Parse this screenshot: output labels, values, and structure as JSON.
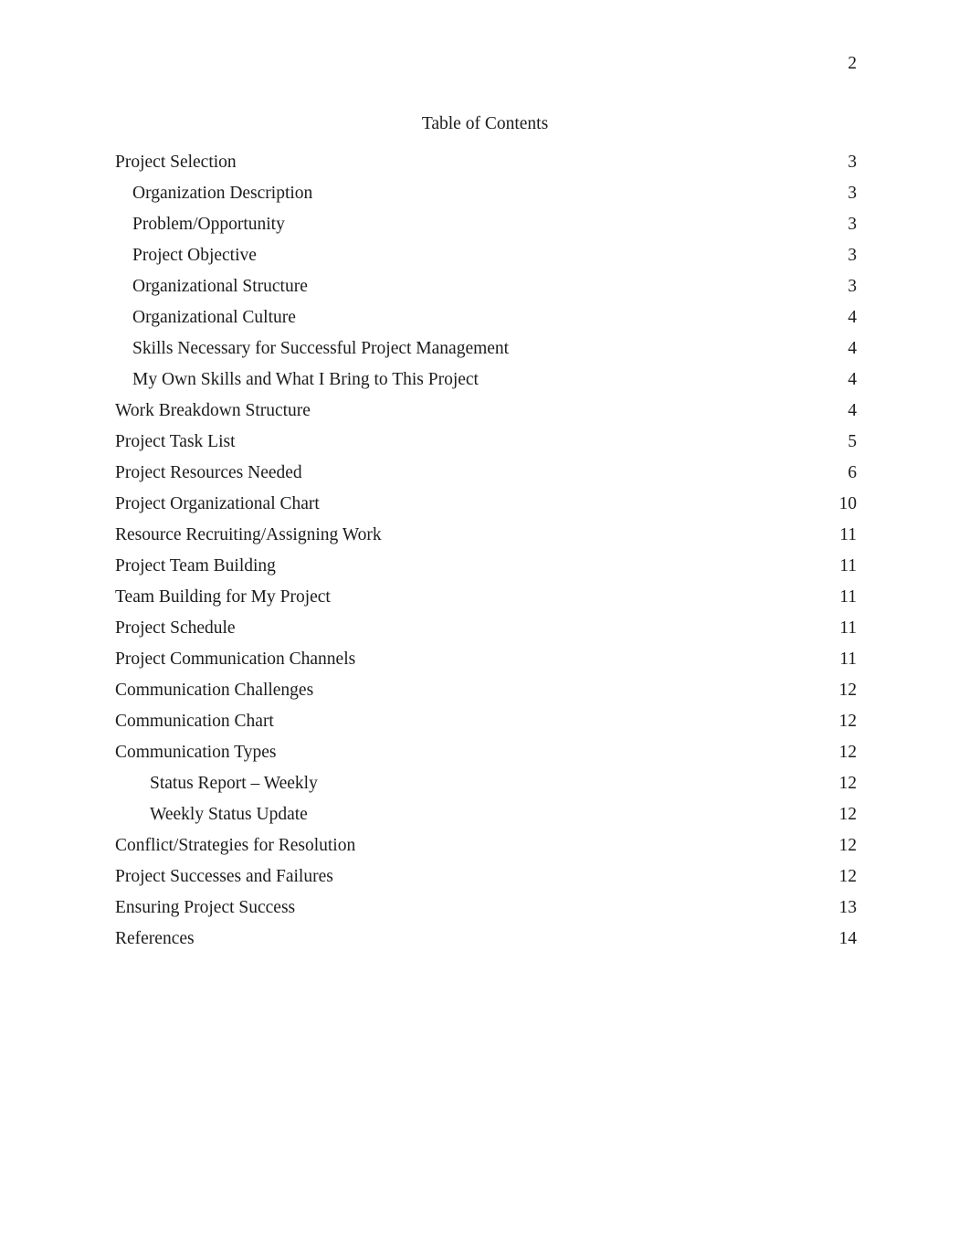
{
  "document": {
    "header_page_number": "2",
    "title": "Table of Contents"
  },
  "toc": {
    "entries": [
      {
        "label": "Project Selection",
        "page": "3",
        "level": 1
      },
      {
        "label": "Organization Description",
        "page": "3",
        "level": 2
      },
      {
        "label": "Problem/Opportunity",
        "page": "3",
        "level": 2
      },
      {
        "label": "Project Objective",
        "page": "3",
        "level": 2
      },
      {
        "label": "Organizational Structure",
        "page": "3",
        "level": 2
      },
      {
        "label": "Organizational Culture",
        "page": "4",
        "level": 2
      },
      {
        "label": "Skills Necessary for Successful Project Management",
        "page": "4",
        "level": 2
      },
      {
        "label": "My Own Skills and What I Bring to This Project",
        "page": "4",
        "level": 2
      },
      {
        "label": "Work Breakdown Structure",
        "page": "4",
        "level": 1
      },
      {
        "label": "Project Task List",
        "page": "5",
        "level": 1
      },
      {
        "label": "Project Resources Needed",
        "page": "6",
        "level": 1
      },
      {
        "label": "Project Organizational Chart",
        "page": "10",
        "level": 1
      },
      {
        "label": "Resource Recruiting/Assigning Work",
        "page": "11",
        "level": 1
      },
      {
        "label": "Project Team Building",
        "page": "11",
        "level": 1
      },
      {
        "label": "Team Building for My Project",
        "page": "11",
        "level": 1
      },
      {
        "label": "Project Schedule",
        "page": "11",
        "level": 1
      },
      {
        "label": "Project Communication Channels",
        "page": "11",
        "level": 1
      },
      {
        "label": "Communication Challenges",
        "page": "12",
        "level": 1
      },
      {
        "label": "Communication Chart",
        "page": "12",
        "level": 1
      },
      {
        "label": "Communication Types",
        "page": "12",
        "level": 1
      },
      {
        "label": "Status Report – Weekly",
        "page": "12",
        "level": 3
      },
      {
        "label": "Weekly Status Update",
        "page": "12",
        "level": 3
      },
      {
        "label": "Conflict/Strategies for Resolution",
        "page": "12",
        "level": 1
      },
      {
        "label": "Project Successes and Failures",
        "page": "12",
        "level": 1
      },
      {
        "label": "Ensuring Project Success",
        "page": "13",
        "level": 1
      },
      {
        "label": "References",
        "page": "14",
        "level": 1
      }
    ]
  }
}
